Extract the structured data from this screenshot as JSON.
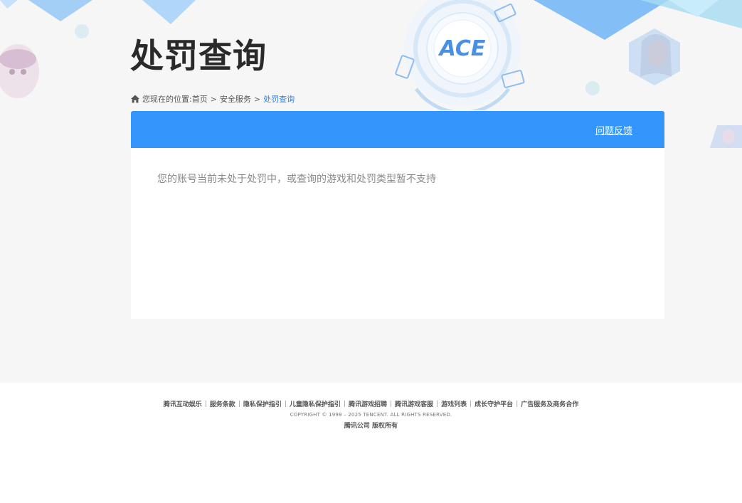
{
  "header": {
    "title": "处罚查询",
    "logo_text": "ACE"
  },
  "breadcrumb": {
    "prefix": "您现在的位置:",
    "items": [
      "首页",
      "安全服务",
      "处罚查询"
    ],
    "separator": ">"
  },
  "panel": {
    "feedback_label": "问题反馈",
    "message": "您的账号当前未处于处罚中，或查询的游戏和处罚类型暂不支持"
  },
  "footer": {
    "links": [
      "腾讯互动娱乐",
      "服务条款",
      "隐私保护指引",
      "儿童隐私保护指引",
      "腾讯游戏招聘",
      "腾讯游戏客服",
      "游戏列表",
      "成长守护平台",
      "广告服务及商务合作"
    ],
    "copyright": "COPYRIGHT © 1998 – 2025 TENCENT. ALL RIGHTS RESERVED.",
    "company": "腾讯公司 版权所有"
  },
  "colors": {
    "accent": "#3495fd",
    "background": "#f6f6f6",
    "breadcrumb_current": "#2f7fd6"
  }
}
